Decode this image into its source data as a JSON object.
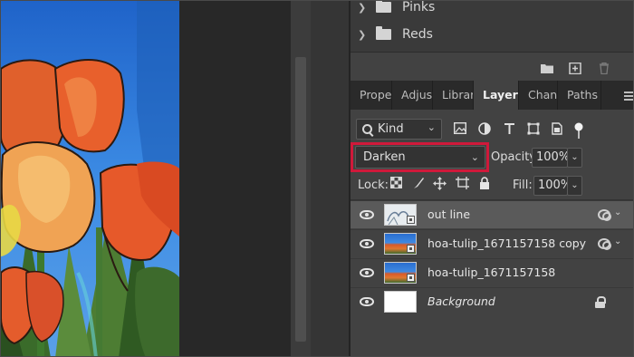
{
  "swatches": {
    "groups": [
      {
        "label": "Pinks",
        "icon": "folder-icon"
      },
      {
        "label": "Reds",
        "icon": "folder-icon"
      }
    ],
    "toolbar_icons": [
      "folder-icon",
      "new-swatch-icon",
      "trash-icon"
    ]
  },
  "tabs": [
    {
      "label": "Proper"
    },
    {
      "label": "Adjust"
    },
    {
      "label": "Librari"
    },
    {
      "label": "Layers",
      "active": true
    },
    {
      "label": "Chann"
    },
    {
      "label": "Paths"
    }
  ],
  "filter": {
    "kind_label": "Kind",
    "icons": [
      "pixel-filter-icon",
      "adjustment-filter-icon",
      "type-filter-icon",
      "shape-filter-icon",
      "smart-object-filter-icon",
      "filter-toggle-icon"
    ]
  },
  "blend": {
    "mode": "Darken",
    "opacity_label": "Opacity:",
    "opacity_value": "100%"
  },
  "lock": {
    "label": "Lock:",
    "icons": [
      "lock-transparent-icon",
      "lock-image-icon",
      "lock-position-icon",
      "lock-artboard-icon",
      "lock-all-icon"
    ],
    "fill_label": "Fill:",
    "fill_value": "100%"
  },
  "layers": [
    {
      "name": "out line",
      "visible": true,
      "selected": true,
      "thumb": "outline",
      "smart_object": true,
      "has_effects": true
    },
    {
      "name": "hoa-tulip_1671157158 copy",
      "visible": true,
      "selected": false,
      "thumb": "tulip",
      "smart_object": true,
      "has_effects": true
    },
    {
      "name": "hoa-tulip_1671157158",
      "visible": true,
      "selected": false,
      "thumb": "tulip",
      "smart_object": true,
      "has_effects": false
    },
    {
      "name": "Background",
      "visible": true,
      "selected": false,
      "thumb": "white",
      "locked": true
    }
  ],
  "colors": {
    "highlight": "#d0193a",
    "panel_bg": "#424242",
    "selected_row": "#5a5a5a"
  }
}
